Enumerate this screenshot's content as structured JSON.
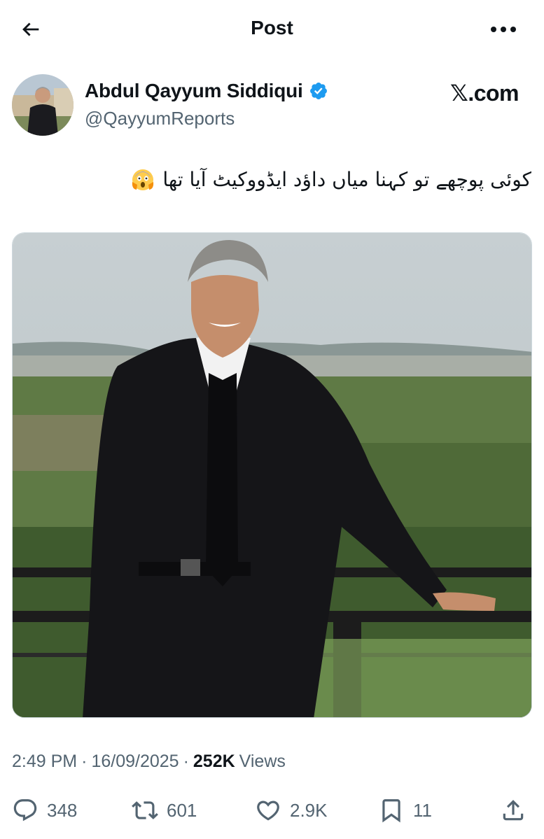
{
  "topbar": {
    "title": "Post",
    "back_icon": "back-arrow-icon",
    "more_icon": "more-horizontal-icon"
  },
  "author": {
    "display_name": "Abdul Qayyum Siddiqui",
    "handle": "@QayyumReports",
    "verified": true,
    "verified_color": "#1d9bf0"
  },
  "watermark": "𝕏.com",
  "tweet": {
    "text": "کوئی پوچھے تو کہنا میاں داؤد ایڈووکیٹ آیا تھا",
    "emoji": "face-screaming-in-fear"
  },
  "meta": {
    "time": "2:49 PM",
    "date": "16/09/2025",
    "sep1": "·",
    "sep2": "·",
    "views_count": "252K",
    "views_label": "Views"
  },
  "actions": {
    "replies": "348",
    "reposts": "601",
    "likes": "2.9K",
    "bookmarks": "11"
  },
  "colors": {
    "text_primary": "#0f1419",
    "text_secondary": "#536471",
    "accent": "#1d9bf0"
  }
}
